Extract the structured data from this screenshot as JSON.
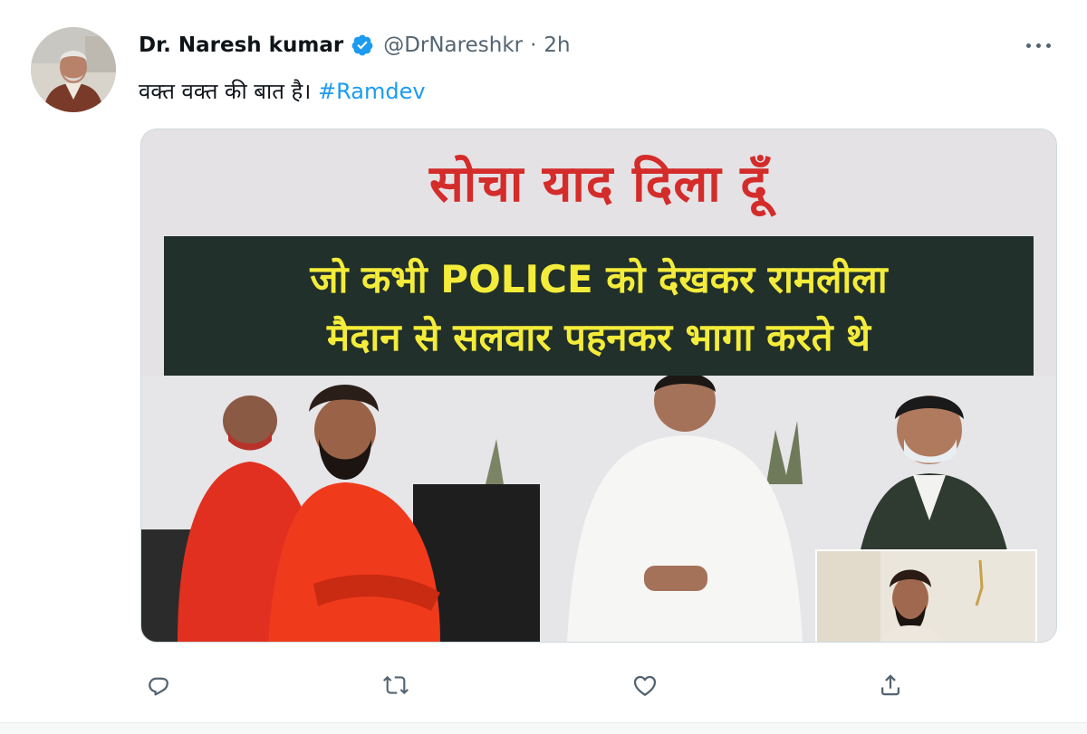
{
  "tweet": {
    "author": {
      "display_name": "Dr. Naresh kumar",
      "handle": "@DrNareshkr",
      "verified": true
    },
    "separator": "·",
    "time": "2h",
    "text": "वक्त वक्त की बात है।",
    "hashtag": "#Ramdev",
    "media": {
      "headline": "सोचा याद दिला दूँ",
      "band_line1": "जो कभी POLICE को देखकर रामलीला",
      "band_line2": "मैदान से सलवार पहनकर भागा करते थे"
    },
    "actions": [
      "reply-icon",
      "retweet-icon",
      "like-icon",
      "share-icon"
    ]
  },
  "colors": {
    "text_primary": "#0f1419",
    "text_secondary": "#536471",
    "link": "#1d9bf0",
    "verified": "#1d9bf0",
    "headline_red": "#d42b2b",
    "band_bg": "#21302a",
    "band_text": "#f4ec3a"
  }
}
